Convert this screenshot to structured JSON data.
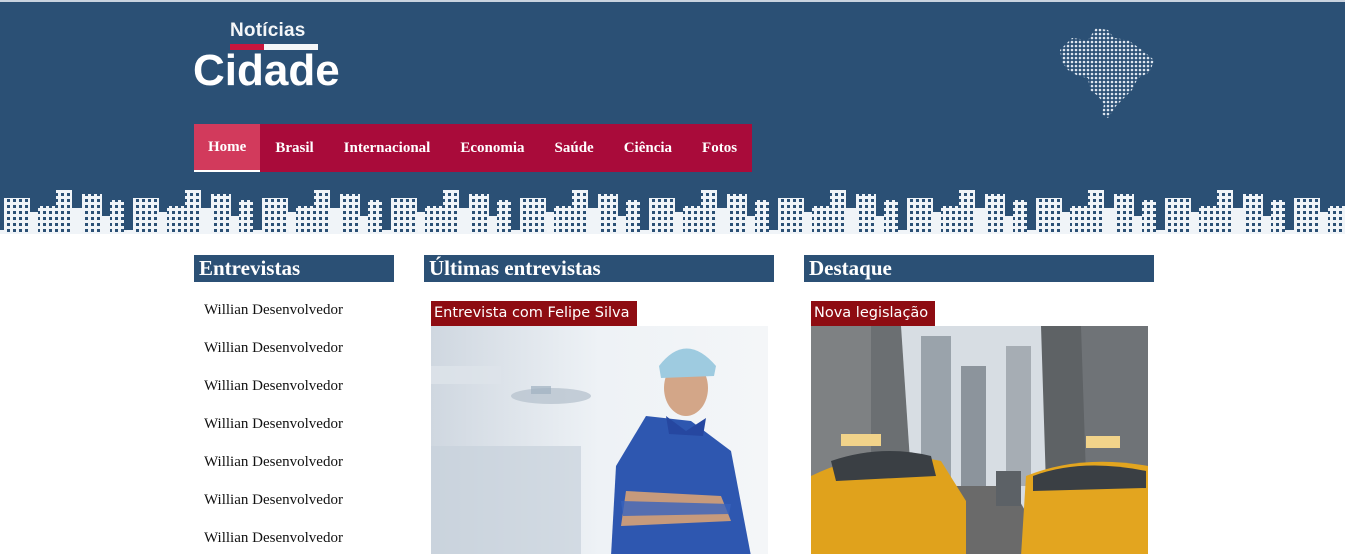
{
  "logo": {
    "top_text": "Notícias",
    "main_text": "Cidade"
  },
  "nav": {
    "items": [
      {
        "label": "Home",
        "active": true
      },
      {
        "label": "Brasil"
      },
      {
        "label": "Internacional"
      },
      {
        "label": "Economia"
      },
      {
        "label": "Saúde"
      },
      {
        "label": "Ciência"
      },
      {
        "label": "Fotos"
      }
    ]
  },
  "sections": {
    "interviews": {
      "title": "Entrevistas",
      "items": [
        "Willian Desenvolvedor",
        "Willian Desenvolvedor",
        "Willian Desenvolvedor",
        "Willian Desenvolvedor",
        "Willian Desenvolvedor",
        "Willian Desenvolvedor",
        "Willian Desenvolvedor"
      ]
    },
    "latest": {
      "title": "Últimas entrevistas",
      "card_label": "Entrevista com Felipe Silva"
    },
    "featured": {
      "title": "Destaque",
      "card_label": "Nova legislação"
    }
  },
  "colors": {
    "header_bg": "#2b5075",
    "nav_bg": "#a90b3a",
    "nav_active": "#d23a5c",
    "card_label_bg": "#8e0c12",
    "logo_accent": "#c8163d"
  },
  "icons": {
    "map": "brazil-map-icon",
    "skyline": "city-skyline"
  }
}
